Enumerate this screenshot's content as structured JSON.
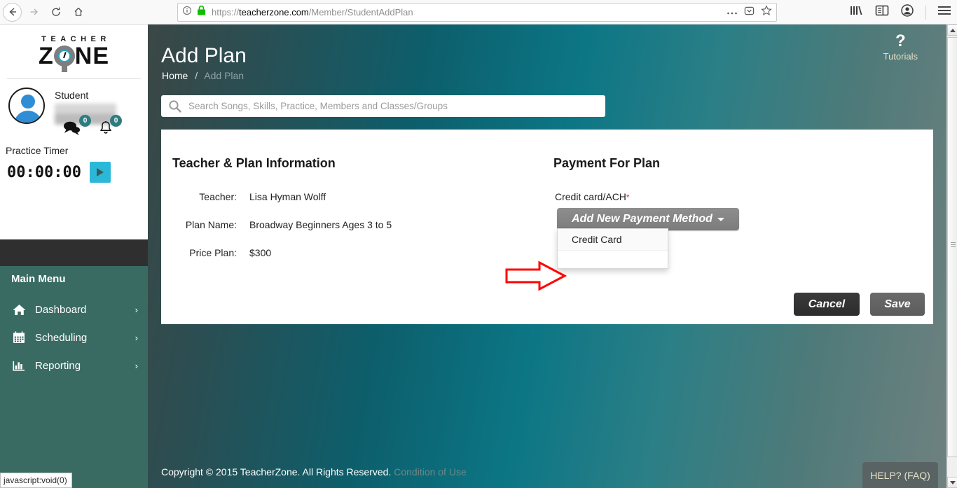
{
  "browser": {
    "url": {
      "scheme": "https://",
      "host": "teacherzone.com",
      "path": "/Member/StudentAddPlan"
    },
    "nav": {
      "back": "back-arrow",
      "forward": "forward-arrow",
      "reload": "reload",
      "home": "home"
    },
    "toolbar_icons": [
      "library-icon",
      "sidebar-icon",
      "account-icon",
      "menu-icon"
    ],
    "url_icons": [
      "info-icon",
      "lock-icon",
      "page-actions-icon",
      "pocket-icon",
      "bookmark-star-icon"
    ],
    "status_tooltip": "javascript:void(0)"
  },
  "sidebar": {
    "logo": {
      "top": "TEACHER",
      "bottom_left": "Z",
      "bottom_right": "NE"
    },
    "profile": {
      "role": "Student",
      "name_masked": ""
    },
    "badges": {
      "messages_count": "0",
      "notifications_count": "0"
    },
    "practice": {
      "label": "Practice Timer",
      "time": "00:00:00",
      "play_label": "play"
    },
    "menu_title": "Main Menu",
    "menu_items": [
      {
        "label": "Dashboard",
        "icon": "home-icon",
        "chevron": "›"
      },
      {
        "label": "Scheduling",
        "icon": "calendar-icon",
        "chevron": "›"
      },
      {
        "label": "Reporting",
        "icon": "bar-chart-icon",
        "chevron": "›"
      }
    ]
  },
  "header": {
    "title": "Add Plan",
    "breadcrumb": {
      "home": "Home",
      "separator": "/",
      "current": "Add Plan"
    },
    "tutorials": {
      "icon": "?",
      "label": "Tutorials"
    }
  },
  "search": {
    "placeholder": "Search Songs, Skills, Practice, Members and Classes/Groups",
    "value": ""
  },
  "card": {
    "left_section_title": "Teacher & Plan Information",
    "fields": [
      {
        "label": "Teacher:",
        "value": "Lisa Hyman Wolff"
      },
      {
        "label": "Plan Name:",
        "value": "Broadway Beginners Ages 3 to 5"
      },
      {
        "label": "Price Plan:",
        "value": "$300"
      }
    ],
    "right_section_title": "Payment For Plan",
    "payment": {
      "field_label": "Credit card/ACH",
      "required_marker": "*",
      "dropdown_button": "Add New Payment Method",
      "dropdown_options": [
        "Credit Card"
      ]
    },
    "buttons": {
      "cancel": "Cancel",
      "save": "Save"
    }
  },
  "footer": {
    "copyright": "Copyright © 2015 TeacherZone. All Rights Reserved.",
    "condition_link": "Condition of Use",
    "help": "HELP? (FAQ)"
  },
  "colors": {
    "accent_teal": "#0c7685",
    "sidebar_menu_green": "#3a6b63",
    "badge_teal": "#2e7d7e",
    "play_cyan": "#2bb8d8",
    "required_red": "#e03030",
    "annotation_red": "#ff0000"
  }
}
